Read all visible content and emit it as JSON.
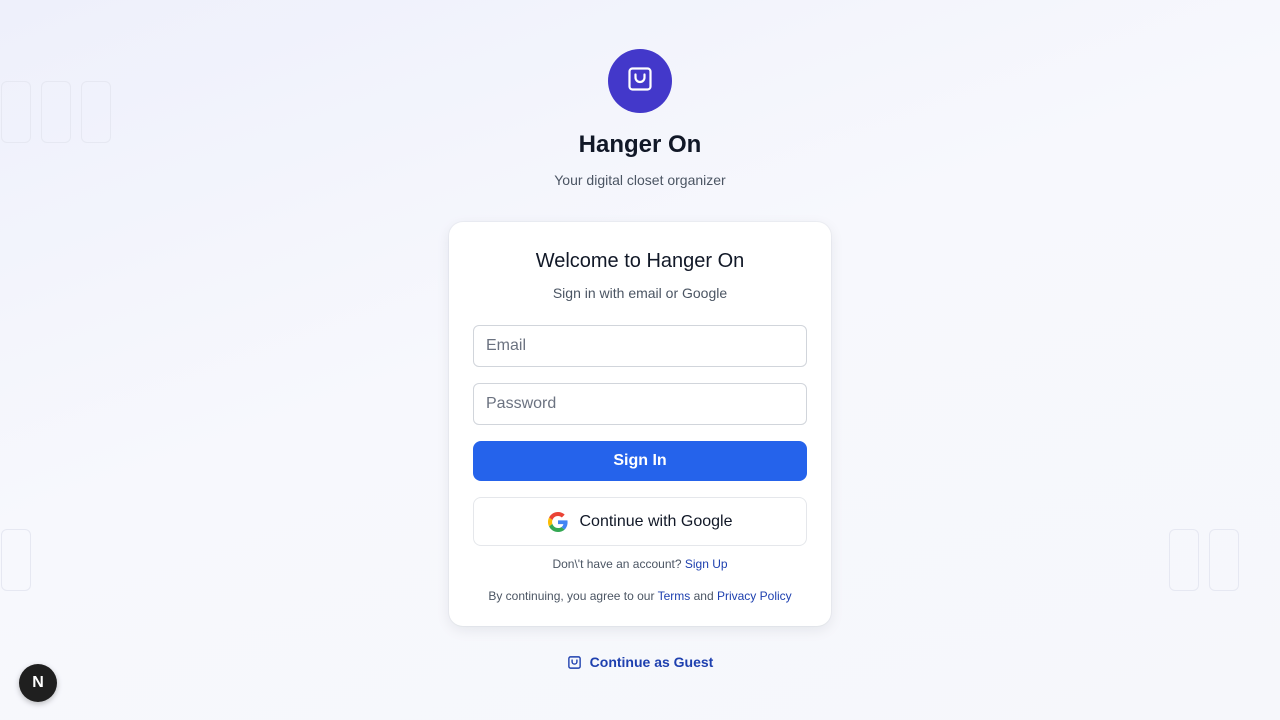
{
  "brand": {
    "title": "Hanger On",
    "subtitle": "Your digital closet organizer",
    "logo_icon": "shopping-bag-icon",
    "logo_color": "#4338ca"
  },
  "card": {
    "title": "Welcome to Hanger On",
    "subtitle": "Sign in with email or Google",
    "email_placeholder": "Email",
    "password_placeholder": "Password",
    "signin_label": "Sign In",
    "google_label": "Continue with Google",
    "signup_prompt": "Don\\'t have an account?",
    "signup_link": "Sign Up",
    "terms_prefix": "By continuing, you agree to our",
    "terms_link": "Terms",
    "terms_and": "and",
    "privacy_link": "Privacy Policy"
  },
  "guest": {
    "label": "Continue as Guest",
    "icon": "shopping-bag-icon"
  },
  "dev_badge": {
    "letter": "N"
  },
  "colors": {
    "primary": "#2563eb",
    "link": "#1e40af",
    "logo": "#4338ca"
  }
}
